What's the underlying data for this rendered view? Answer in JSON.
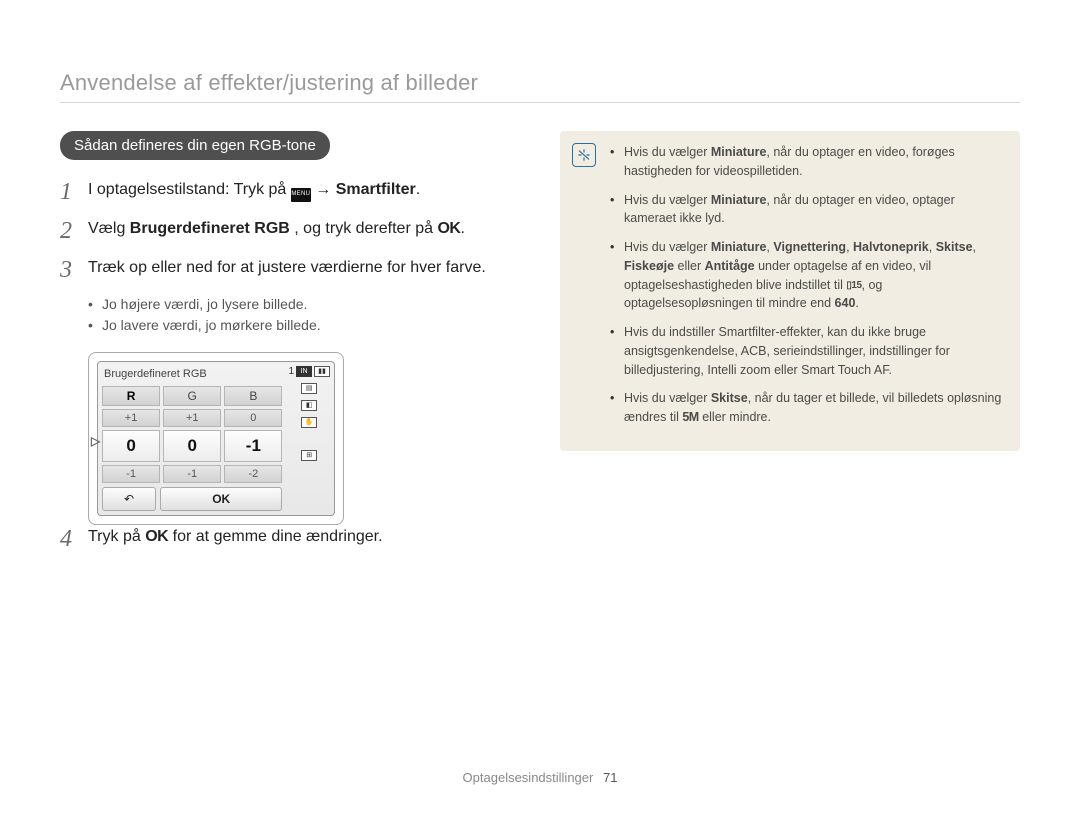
{
  "page_title": "Anvendelse af effekter/justering af billeder",
  "pill": "Sådan defineres din egen RGB-tone",
  "steps": {
    "s1_a": "I optagelsestilstand: Tryk på ",
    "s1_b": " → ",
    "s1_c": "Smartfilter",
    "s1_d": ".",
    "s2_a": "Vælg ",
    "s2_b": "Brugerdefineret RGB",
    "s2_c": ", og tryk derefter på ",
    "s2_ok": "OK",
    "s2_d": ".",
    "s3": "Træk op eller ned for at justere værdierne for hver farve.",
    "s4_a": "Tryk på ",
    "s4_ok": "OK",
    "s4_b": " for at gemme dine ændringer."
  },
  "sub_bullets": [
    "Jo højere værdi, jo lysere billede.",
    "Jo lavere værdi, jo mørkere billede."
  ],
  "lcd": {
    "title": "Brugerdefineret RGB",
    "count": "1",
    "headers": {
      "r": "R",
      "g": "G",
      "b": "B"
    },
    "rows": {
      "top": {
        "r": "+1",
        "g": "+1",
        "b": "0"
      },
      "center": {
        "r": "0",
        "g": "0",
        "b": "-1"
      },
      "bottom": {
        "r": "-1",
        "g": "-1",
        "b": "-2"
      }
    },
    "ok": "OK",
    "back": "↶"
  },
  "note": {
    "items": [
      {
        "html": [
          {
            "t": "Hvis du vælger "
          },
          {
            "t": "Miniature",
            "b": true
          },
          {
            "t": ", når du optager en video, forøges hastigheden for videospilletiden."
          }
        ]
      },
      {
        "html": [
          {
            "t": "Hvis du vælger "
          },
          {
            "t": "Miniature",
            "b": true
          },
          {
            "t": ", når du optager en video, optager kameraet ikke lyd."
          }
        ]
      },
      {
        "html": [
          {
            "t": "Hvis du vælger "
          },
          {
            "t": "Miniature",
            "b": true
          },
          {
            "t": ", "
          },
          {
            "t": "Vignettering",
            "b": true
          },
          {
            "t": ", "
          },
          {
            "t": "Halvtoneprik",
            "b": true
          },
          {
            "t": ", "
          },
          {
            "t": "Skitse",
            "b": true
          },
          {
            "t": ", "
          },
          {
            "t": "Fiskeøje",
            "b": true
          },
          {
            "t": " eller "
          },
          {
            "t": "Antitåge",
            "b": true
          },
          {
            "t": " under optagelse af en video, vil optagelseshastigheden blive indstillet til "
          },
          {
            "t": "",
            "icon": "fps15"
          },
          {
            "t": ", og optagelsesopløsningen til mindre end "
          },
          {
            "t": "640",
            "b": true
          },
          {
            "t": "."
          }
        ]
      },
      {
        "html": [
          {
            "t": "Hvis du indstiller Smartfilter-effekter, kan du ikke bruge ansigtsgenkendelse, ACB, serieindstillinger, indstillinger for billedjustering, Intelli zoom eller Smart Touch AF."
          }
        ]
      },
      {
        "html": [
          {
            "t": "Hvis du vælger "
          },
          {
            "t": "Skitse",
            "b": true
          },
          {
            "t": ", når du tager et billede, vil billedets opløsning ændres til "
          },
          {
            "t": "",
            "icon": "5m"
          },
          {
            "t": " eller mindre."
          }
        ]
      }
    ]
  },
  "footer": {
    "section": "Optagelsesindstillinger",
    "page": "71"
  },
  "icons": {
    "menu": "MENU",
    "fps15": "▯15",
    "fivem": "5M"
  }
}
